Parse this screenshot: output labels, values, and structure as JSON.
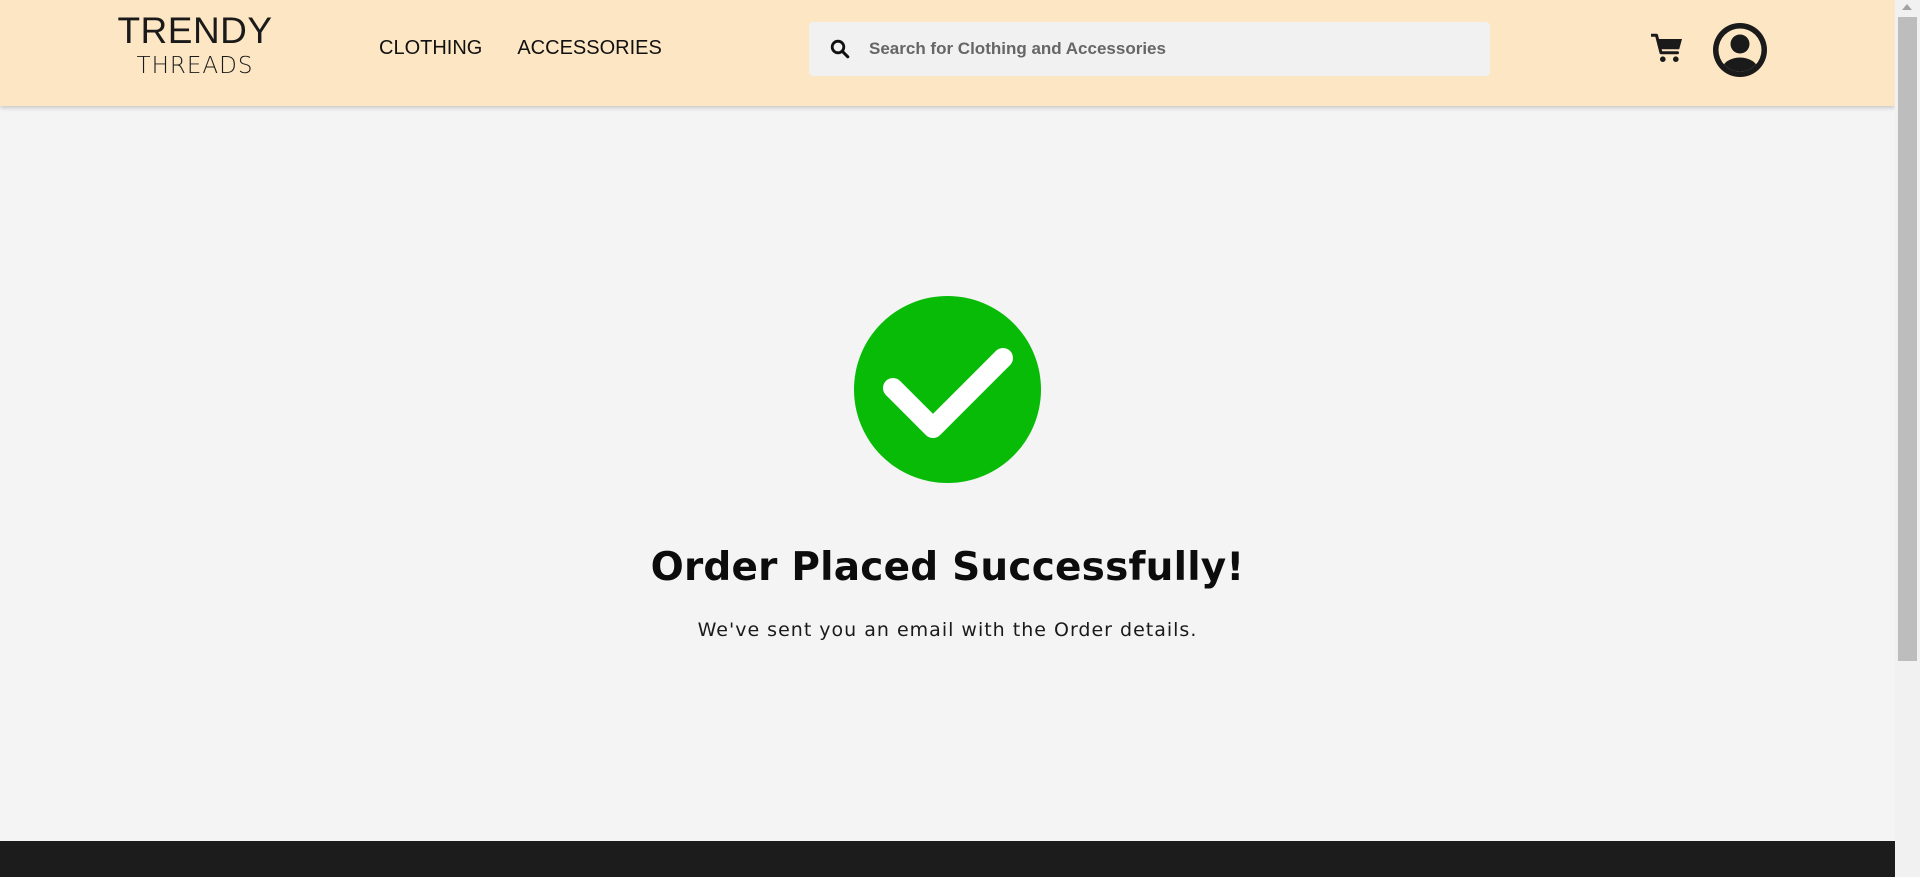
{
  "brand": {
    "line1": "TRENDY",
    "line2": "THREADS"
  },
  "nav": {
    "items": [
      {
        "label": "CLOTHING"
      },
      {
        "label": "ACCESSORIES"
      }
    ]
  },
  "search": {
    "placeholder": "Search for Clothing and Accessories",
    "value": ""
  },
  "icons": {
    "search": "search-icon",
    "cart": "cart-icon",
    "account": "user-circle-icon",
    "success": "check-circle-icon"
  },
  "main": {
    "title": "Order Placed Successfully!",
    "message": "We've sent you an email with the Order details."
  },
  "colors": {
    "header_bg": "#fde6c4",
    "page_bg": "#f4f4f4",
    "success_green": "#07bb07",
    "footer_bg": "#1c1c1c",
    "icon_dark": "#1a1a1a"
  }
}
